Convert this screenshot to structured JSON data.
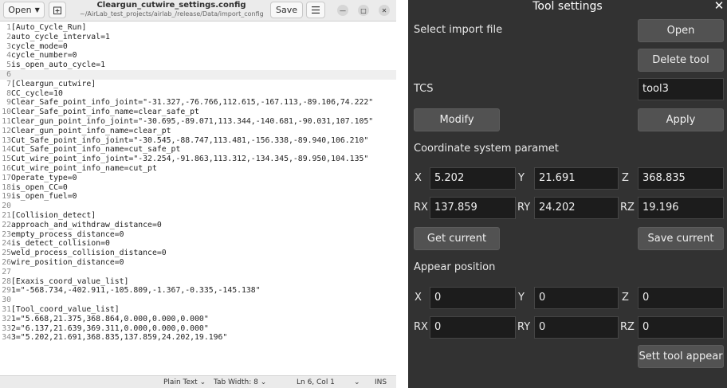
{
  "editor": {
    "open_label": "Open",
    "save_label": "Save",
    "title": "Cleargun_cutwire_settings.config",
    "path": "~/AirLab_test_projects/airlab_/release/Data/import_config",
    "lines": [
      {
        "n": "1",
        "text": "[Auto_Cycle_Run]"
      },
      {
        "n": "2",
        "text": "auto_cycle_interval=1"
      },
      {
        "n": "3",
        "text": "cycle_mode=0"
      },
      {
        "n": "4",
        "text": "cycle_number=0"
      },
      {
        "n": "5",
        "text": "is_open_auto_cycle=1"
      },
      {
        "n": "6",
        "text": ""
      },
      {
        "n": "7",
        "text": "[Cleargun_cutwire]"
      },
      {
        "n": "8",
        "text": "CC_cycle=10"
      },
      {
        "n": "9",
        "text": "Clear_Safe_point_info_joint=\"-31.327,-76.766,112.615,-167.113,-89.106,74.222\""
      },
      {
        "n": "10",
        "text": "Clear_Safe_point_info_name=clear_safe_pt"
      },
      {
        "n": "11",
        "text": "Clear_gun_point_info_joint=\"-30.695,-89.071,113.344,-140.681,-90.031,107.105\""
      },
      {
        "n": "12",
        "text": "Clear_gun_point_info_name=clear_pt"
      },
      {
        "n": "13",
        "text": "Cut_Safe_point_info_joint=\"-30.545,-88.747,113.481,-156.338,-89.940,106.210\""
      },
      {
        "n": "14",
        "text": "Cut_Safe_point_info_name=cut_safe_pt"
      },
      {
        "n": "15",
        "text": "Cut_wire_point_info_joint=\"-32.254,-91.863,113.312,-134.345,-89.950,104.135\""
      },
      {
        "n": "16",
        "text": "Cut_wire_point_info_name=cut_pt"
      },
      {
        "n": "17",
        "text": "Operate_type=0"
      },
      {
        "n": "18",
        "text": "is_open_CC=0"
      },
      {
        "n": "19",
        "text": "is_open_fuel=0"
      },
      {
        "n": "20",
        "text": ""
      },
      {
        "n": "21",
        "text": "[Collision_detect]"
      },
      {
        "n": "22",
        "text": "approach_and_withdraw_distance=0"
      },
      {
        "n": "23",
        "text": "empty_process_distance=0"
      },
      {
        "n": "24",
        "text": "is_detect_collision=0"
      },
      {
        "n": "25",
        "text": "weld_process_collision_distance=0"
      },
      {
        "n": "26",
        "text": "wire_position_distance=0"
      },
      {
        "n": "27",
        "text": ""
      },
      {
        "n": "28",
        "text": "[Exaxis_coord_value_list]"
      },
      {
        "n": "29",
        "text": "1=\"-568.734,-402.911,-105.809,-1.367,-0.335,-145.138\""
      },
      {
        "n": "30",
        "text": ""
      },
      {
        "n": "31",
        "text": "[Tool_coord_value_list]"
      },
      {
        "n": "32",
        "text": "1=\"5.668,21.375,368.864,0.000,0.000,0.000\""
      },
      {
        "n": "33",
        "text": "2=\"6.137,21.639,369.311,0.000,0.000,0.000\""
      },
      {
        "n": "34",
        "text": "3=\"5.202,21.691,368.835,137.859,24.202,19.196\""
      }
    ],
    "status": {
      "language": "Plain Text",
      "tab_width": "Tab Width: 8",
      "position": "Ln 6, Col 1",
      "mode": "INS"
    }
  },
  "tool_settings": {
    "title": "Tool settings",
    "select_import_label": "Select import file",
    "open_label": "Open",
    "delete_tool_label": "Delete tool",
    "tcs_label": "TCS",
    "tcs_value": "tool3",
    "modify_label": "Modify",
    "apply_label": "Apply",
    "coord_section_label": "Coordinate system paramet",
    "coord": {
      "x_label": "X",
      "x": "5.202",
      "y_label": "Y",
      "y": "21.691",
      "z_label": "Z",
      "z": "368.835",
      "rx_label": "RX",
      "rx": "137.859",
      "ry_label": "RY",
      "ry": "24.202",
      "rz_label": "RZ",
      "rz": "19.196"
    },
    "get_current_label": "Get current",
    "save_current_label": "Save current",
    "appear_section_label": "Appear position",
    "appear": {
      "x_label": "X",
      "x": "0",
      "y_label": "Y",
      "y": "0",
      "z_label": "Z",
      "z": "0",
      "rx_label": "RX",
      "rx": "0",
      "ry_label": "RY",
      "ry": "0",
      "rz_label": "RZ",
      "rz": "0"
    },
    "sett_tool_appear_label": "Sett tool appear"
  }
}
